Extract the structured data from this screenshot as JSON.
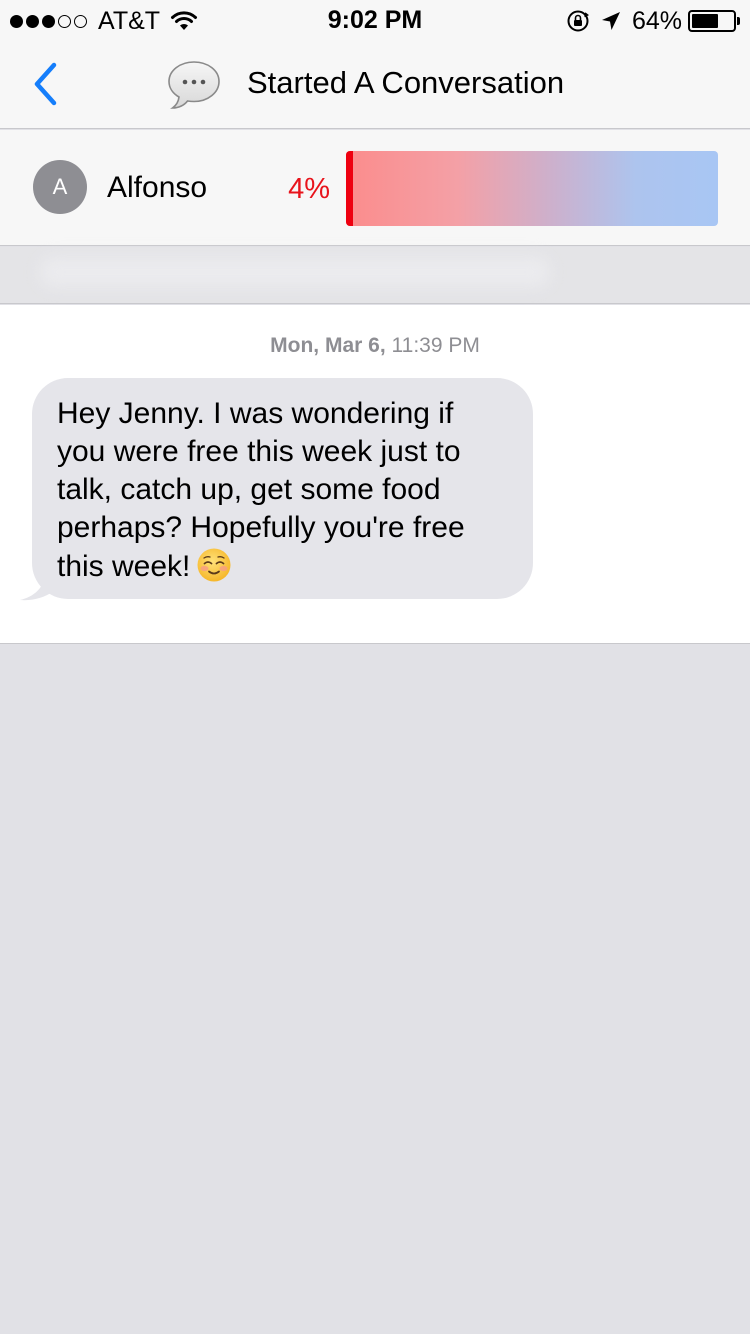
{
  "status_bar": {
    "carrier": "AT&T",
    "signal_bars_filled": 3,
    "signal_bars_total": 5,
    "time": "9:02 PM",
    "battery_percent": "64%",
    "battery_level": 0.64,
    "icons": [
      "wifi-icon",
      "orientation-lock-icon",
      "location-arrow-icon",
      "battery-icon"
    ]
  },
  "nav": {
    "back_icon": "chevron-left-icon",
    "title_icon": "speech-bubble-icon",
    "title": "Started A Conversation"
  },
  "contact": {
    "initial": "A",
    "name": "Alfonso",
    "percent_label": "4%",
    "percent_value": 0.04,
    "colors": {
      "percent": "#e8141c",
      "meter_start": "#fb8c8c",
      "meter_end": "#a8c6f4"
    }
  },
  "conversation": {
    "timestamp_day": "Mon, Mar 6,",
    "timestamp_time": "11:39 PM",
    "message": {
      "text": "Hey Jenny. I was wondering if you were free this week just to talk, catch up, get some food perhaps? Hopefully you're free this week!",
      "emoji": "smiling-face-icon"
    }
  },
  "colors": {
    "accent": "#157efb",
    "bubble": "#e5e5ea",
    "background": "#e1e1e6"
  }
}
